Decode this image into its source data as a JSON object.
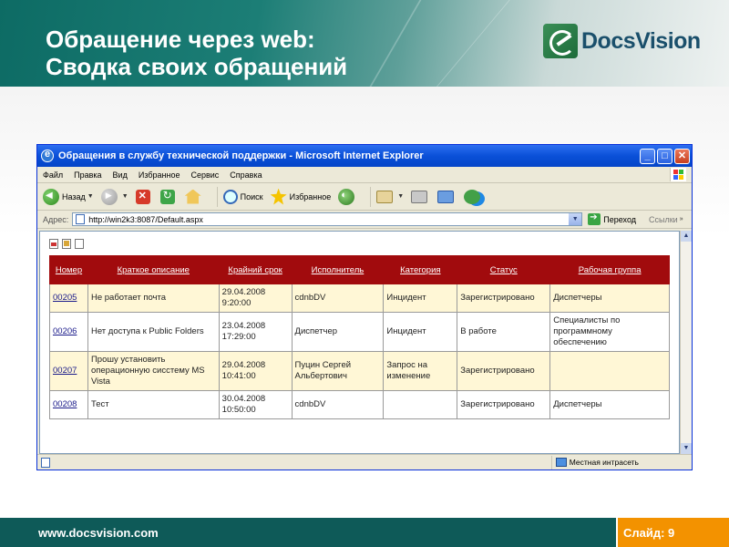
{
  "slide": {
    "title_line1": "Обращение через web:",
    "title_line2": "Сводка своих обращений",
    "logo_text": "DocsVision",
    "footer_url": "www.docsvision.com",
    "footer_slide": "Слайд: 9"
  },
  "browser": {
    "title": "Обращения в службу технической поддержки - Microsoft Internet Explorer",
    "menu": [
      "Файл",
      "Правка",
      "Вид",
      "Избранное",
      "Сервис",
      "Справка"
    ],
    "toolbar": {
      "back": "Назад",
      "search": "Поиск",
      "favorites": "Избранное"
    },
    "address": {
      "label": "Адрес:",
      "url": "http://win2k3:8087/Default.aspx",
      "go": "Переход",
      "links": "Ссылки"
    },
    "status": {
      "zone": "Местная интрасеть"
    }
  },
  "table": {
    "headers": [
      "Номер",
      "Краткое описание",
      "Крайний срок",
      "Исполнитель",
      "Категория",
      "Статус",
      "Рабочая группа"
    ],
    "rows": [
      {
        "num": "00205",
        "desc": "Не работает почта",
        "deadline_date": "29.04.2008",
        "deadline_time": "9:20:00",
        "assignee": "cdnbDV",
        "category": "Инцидент",
        "status": "Зарегистрировано",
        "group": "Диспетчеры"
      },
      {
        "num": "00206",
        "desc": "Нет доступа к Public Folders",
        "deadline_date": "23.04.2008",
        "deadline_time": "17:29:00",
        "assignee": "Диспетчер",
        "category": "Инцидент",
        "status": "В работе",
        "group": "Специалисты по программному обеспечению"
      },
      {
        "num": "00207",
        "desc": "Прошу установить операционную сисстему MS Vista",
        "deadline_date": "29.04.2008",
        "deadline_time": "10:41:00",
        "assignee": "Пуцин Сергей Альбертович",
        "category": "Запрос на изменение",
        "status": "Зарегистрировано",
        "group": ""
      },
      {
        "num": "00208",
        "desc": "Тест",
        "deadline_date": "30.04.2008",
        "deadline_time": "10:50:00",
        "assignee": "cdnbDV",
        "category": "",
        "status": "Зарегистрировано",
        "group": "Диспетчеры"
      }
    ]
  }
}
